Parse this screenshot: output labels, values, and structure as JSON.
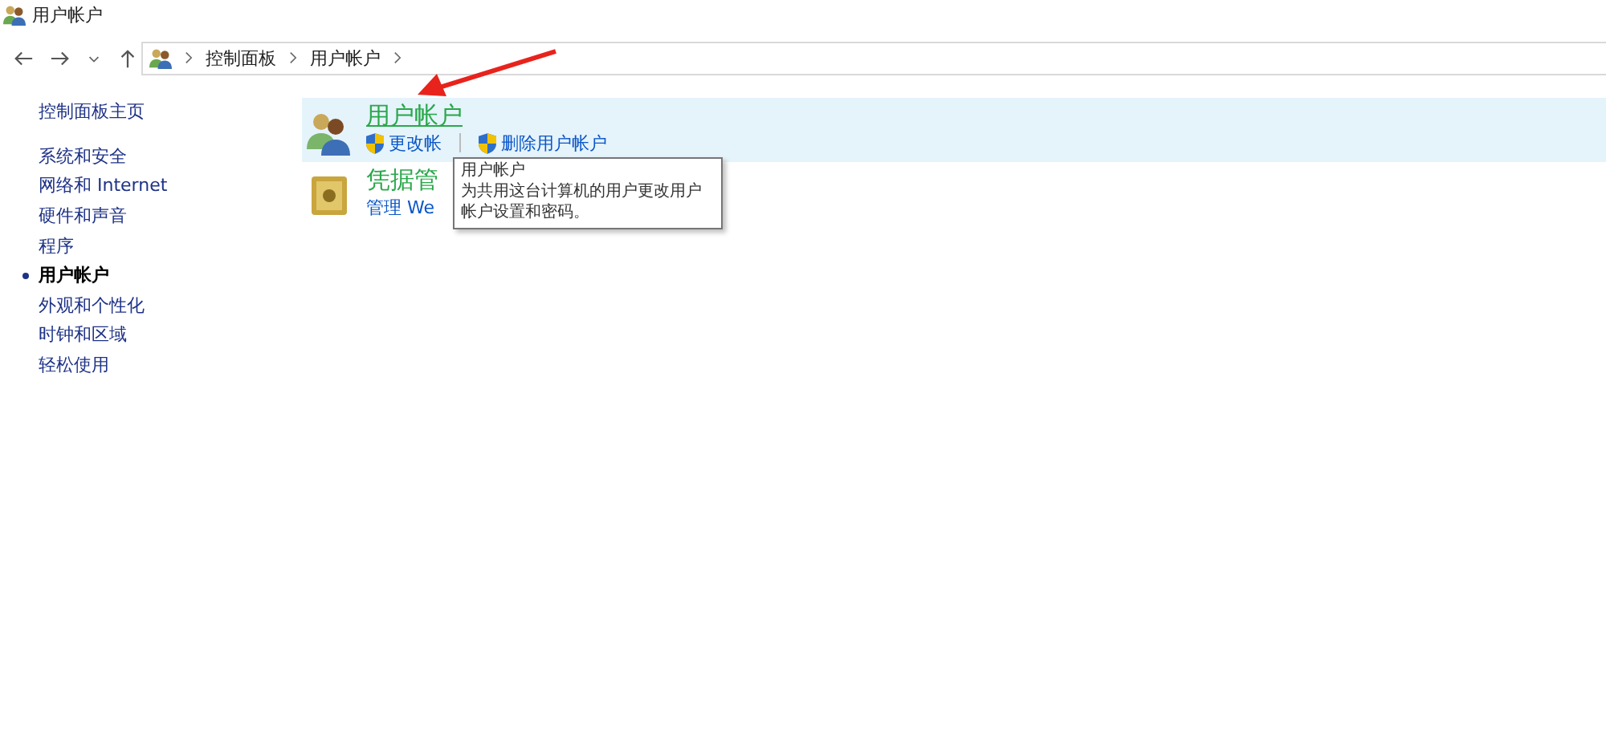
{
  "window": {
    "title": "用户帐户"
  },
  "address_bar": {
    "crumbs": [
      "控制面板",
      "用户帐户"
    ]
  },
  "sidebar": {
    "home": "控制面板主页",
    "items": [
      {
        "label": "系统和安全",
        "selected": false
      },
      {
        "label": "网络和 Internet",
        "selected": false
      },
      {
        "label": "硬件和声音",
        "selected": false
      },
      {
        "label": "程序",
        "selected": false
      },
      {
        "label": "用户帐户",
        "selected": true
      },
      {
        "label": "外观和个性化",
        "selected": false
      },
      {
        "label": "时钟和区域",
        "selected": false
      },
      {
        "label": "轻松使用",
        "selected": false
      }
    ]
  },
  "categories": [
    {
      "kind": "users",
      "title": "用户帐户",
      "highlighted": true,
      "links": [
        "更改帐",
        "删除用户帐户"
      ]
    },
    {
      "kind": "safe",
      "title": "凭据管",
      "highlighted": false,
      "links": [
        "管理 We"
      ]
    }
  ],
  "tooltip": {
    "title": "用户帐户",
    "text": "为共用这台计算机的用户更改用户帐户设置和密码。"
  }
}
